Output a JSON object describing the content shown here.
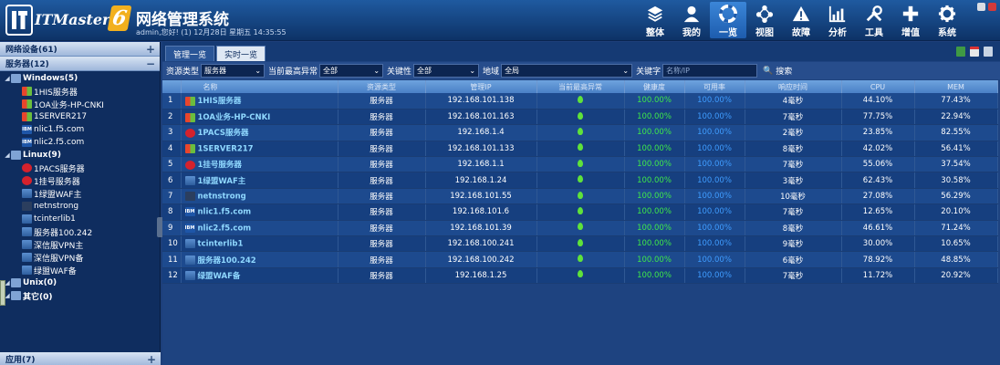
{
  "header": {
    "logo_text": "ITMaster",
    "logo_version": "6",
    "title": "网络管理系统",
    "subtitle": "admin,您好! (1) 12月28日 星期五 14:35:55",
    "nav": [
      {
        "label": "整体",
        "icon": "layers-icon"
      },
      {
        "label": "我的",
        "icon": "user-icon"
      },
      {
        "label": "一览",
        "icon": "lifebuoy-icon"
      },
      {
        "label": "视图",
        "icon": "network-view-icon"
      },
      {
        "label": "故障",
        "icon": "warning-icon"
      },
      {
        "label": "分析",
        "icon": "chart-icon"
      },
      {
        "label": "工具",
        "icon": "tools-icon"
      },
      {
        "label": "增值",
        "icon": "plus-icon"
      },
      {
        "label": "系统",
        "icon": "gear-icon"
      }
    ]
  },
  "sidebar": {
    "group1": "网络设备(61)",
    "group2": "服务器(12)",
    "tree": [
      {
        "label": "Windows(5)",
        "level": 0,
        "icon": "group"
      },
      {
        "label": "1HIS服务器",
        "level": 1,
        "icon": "win"
      },
      {
        "label": "1OA业务-HP-CNKI",
        "level": 1,
        "icon": "win"
      },
      {
        "label": "1SERVER217",
        "level": 1,
        "icon": "win"
      },
      {
        "label": "nlic1.f5.com",
        "level": 1,
        "icon": "ibm"
      },
      {
        "label": "nlic2.f5.com",
        "level": 1,
        "icon": "ibm"
      },
      {
        "label": "Linux(9)",
        "level": 0,
        "icon": "group"
      },
      {
        "label": "1PACS服务器",
        "level": 1,
        "icon": "f5"
      },
      {
        "label": "1挂号服务器",
        "level": 1,
        "icon": "f5"
      },
      {
        "label": "1绿盟WAF主",
        "level": 1,
        "icon": "dev"
      },
      {
        "label": "netnstrong",
        "level": 1,
        "icon": "net"
      },
      {
        "label": "tcinterlib1",
        "level": 1,
        "icon": "dev"
      },
      {
        "label": "服务器100.242",
        "level": 1,
        "icon": "dev"
      },
      {
        "label": "深信服VPN主",
        "level": 1,
        "icon": "dev"
      },
      {
        "label": "深信服VPN备",
        "level": 1,
        "icon": "dev"
      },
      {
        "label": "绿盟WAF备",
        "level": 1,
        "icon": "dev"
      },
      {
        "label": "Unix(0)",
        "level": 0,
        "icon": "group"
      },
      {
        "label": "其它(0)",
        "level": 0,
        "icon": "group"
      }
    ],
    "bottom_group": "应用(7)"
  },
  "tabs": [
    {
      "label": "管理一览",
      "active": false
    },
    {
      "label": "实时一览",
      "active": true
    }
  ],
  "filter": {
    "type_label": "资源类型",
    "type_value": "服务器",
    "abn_label": "当前最高异常",
    "abn_value": "全部",
    "key_label": "关键性",
    "key_value": "全部",
    "region_label": "地域",
    "region_value": "全局",
    "kw_label": "关键字",
    "kw_placeholder": "名称/IP",
    "search_label": "搜索"
  },
  "table": {
    "columns": [
      "",
      "名称",
      "资源类型",
      "管理IP",
      "当前最高异常",
      "健康度",
      "可用率",
      "响应时间",
      "CPU",
      "MEM"
    ],
    "rows": [
      {
        "idx": "1",
        "name": "1HIS服务器",
        "icon": "win",
        "type": "服务器",
        "ip": "192.168.101.138",
        "health": "100.00%",
        "avail": "100.00%",
        "resp": "4毫秒",
        "cpu": "44.10%",
        "mem": "77.43%"
      },
      {
        "idx": "2",
        "name": "1OA业务-HP-CNKI",
        "icon": "win",
        "type": "服务器",
        "ip": "192.168.101.163",
        "health": "100.00%",
        "avail": "100.00%",
        "resp": "7毫秒",
        "cpu": "77.75%",
        "mem": "22.94%"
      },
      {
        "idx": "3",
        "name": "1PACS服务器",
        "icon": "f5",
        "type": "服务器",
        "ip": "192.168.1.4",
        "health": "100.00%",
        "avail": "100.00%",
        "resp": "2毫秒",
        "cpu": "23.85%",
        "mem": "82.55%"
      },
      {
        "idx": "4",
        "name": "1SERVER217",
        "icon": "win",
        "type": "服务器",
        "ip": "192.168.101.133",
        "health": "100.00%",
        "avail": "100.00%",
        "resp": "8毫秒",
        "cpu": "42.02%",
        "mem": "56.41%"
      },
      {
        "idx": "5",
        "name": "1挂号服务器",
        "icon": "f5",
        "type": "服务器",
        "ip": "192.168.1.1",
        "health": "100.00%",
        "avail": "100.00%",
        "resp": "7毫秒",
        "cpu": "55.06%",
        "mem": "37.54%"
      },
      {
        "idx": "6",
        "name": "1绿盟WAF主",
        "icon": "dev",
        "type": "服务器",
        "ip": "192.168.1.24",
        "health": "100.00%",
        "avail": "100.00%",
        "resp": "3毫秒",
        "cpu": "62.43%",
        "mem": "30.58%"
      },
      {
        "idx": "7",
        "name": "netnstrong",
        "icon": "net",
        "type": "服务器",
        "ip": "192.168.101.55",
        "health": "100.00%",
        "avail": "100.00%",
        "resp": "10毫秒",
        "cpu": "27.08%",
        "mem": "56.29%"
      },
      {
        "idx": "8",
        "name": "nlic1.f5.com",
        "icon": "ibm",
        "type": "服务器",
        "ip": "192.168.101.6",
        "health": "100.00%",
        "avail": "100.00%",
        "resp": "7毫秒",
        "cpu": "12.65%",
        "mem": "20.10%"
      },
      {
        "idx": "9",
        "name": "nlic2.f5.com",
        "icon": "ibm",
        "type": "服务器",
        "ip": "192.168.101.39",
        "health": "100.00%",
        "avail": "100.00%",
        "resp": "8毫秒",
        "cpu": "46.61%",
        "mem": "71.24%"
      },
      {
        "idx": "10",
        "name": "tcinterlib1",
        "icon": "dev",
        "type": "服务器",
        "ip": "192.168.100.241",
        "health": "100.00%",
        "avail": "100.00%",
        "resp": "9毫秒",
        "cpu": "30.00%",
        "mem": "10.65%"
      },
      {
        "idx": "11",
        "name": "服务器100.242",
        "icon": "dev",
        "type": "服务器",
        "ip": "192.168.100.242",
        "health": "100.00%",
        "avail": "100.00%",
        "resp": "6毫秒",
        "cpu": "78.92%",
        "mem": "48.85%"
      },
      {
        "idx": "12",
        "name": "绿盟WAF备",
        "icon": "dev",
        "type": "服务器",
        "ip": "192.168.1.25",
        "health": "100.00%",
        "avail": "100.00%",
        "resp": "7毫秒",
        "cpu": "11.72%",
        "mem": "20.92%"
      }
    ]
  },
  "colors": {
    "header_bg": "#1f5aa0",
    "table_bg": "#1d4a8e",
    "ok_green": "#3ee84a",
    "avail_blue": "#3f9cff",
    "name_cyan": "#8fd8ff",
    "logo_orange": "#f2b01e"
  }
}
